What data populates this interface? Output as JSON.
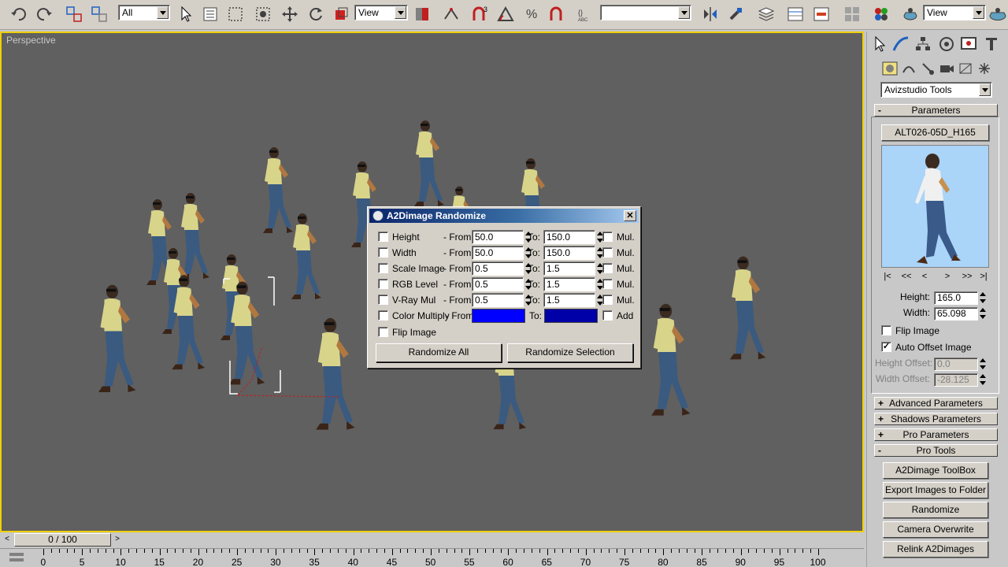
{
  "toolbar": {
    "selection_filter": "All",
    "coord_system_1": "View",
    "named_selection": "",
    "coord_system_2": "View"
  },
  "viewport": {
    "label": "Perspective"
  },
  "dialog": {
    "title": "A2Dimage Randomize",
    "close": "✕",
    "rows": [
      {
        "label": "Height",
        "from_label": "- From:",
        "from": "50.0",
        "to_label": "To:",
        "to": "150.0",
        "mul_label": "Mul."
      },
      {
        "label": "Width",
        "from_label": "- From:",
        "from": "50.0",
        "to_label": "To:",
        "to": "150.0",
        "mul_label": "Mul."
      },
      {
        "label": "Scale Image",
        "from_label": "- From:",
        "from": "0.5",
        "to_label": "To:",
        "to": "1.5",
        "mul_label": "Mul."
      },
      {
        "label": "RGB Level",
        "from_label": "- From:",
        "from": "0.5",
        "to_label": "To:",
        "to": "1.5",
        "mul_label": "Mul."
      },
      {
        "label": "V-Ray Mul",
        "from_label": "- From:",
        "from": "0.5",
        "to_label": "To:",
        "to": "1.5",
        "mul_label": "Mul."
      }
    ],
    "color_row": {
      "label": "Color Multiply",
      "from_label": "- From:",
      "to_label": "To:",
      "add_label": "Add",
      "from_color": "#0000ff",
      "to_color": "#0000a8"
    },
    "flip_label": "Flip Image",
    "randomize_all": "Randomize All",
    "randomize_selection": "Randomize Selection"
  },
  "panel": {
    "tools_dropdown": "Avizstudio Tools",
    "parameters_title": "Parameters",
    "image_name": "ALT026-05D_H165",
    "nav": [
      "|<",
      "<<",
      "<",
      ">",
      ">>",
      ">|"
    ],
    "height_label": "Height:",
    "height_value": "165.0",
    "width_label": "Width:",
    "width_value": "65.098",
    "flip_label": "Flip Image",
    "auto_offset_label": "Auto Offset Image",
    "auto_offset_check": "✓",
    "height_offset_label": "Height Offset:",
    "height_offset_value": "0.0",
    "width_offset_label": "Width Offset:",
    "width_offset_value": "-28.125",
    "rollouts": [
      {
        "sign": "-",
        "label": "Parameters"
      },
      {
        "sign": "+",
        "label": "Advanced Parameters"
      },
      {
        "sign": "+",
        "label": "Shadows Parameters"
      },
      {
        "sign": "+",
        "label": "Pro Parameters"
      },
      {
        "sign": "-",
        "label": "Pro Tools"
      }
    ],
    "pro_tools": [
      "A2Dimage ToolBox",
      "Export Images to Folder",
      "Randomize",
      "Camera Overwrite",
      "Relink A2Dimages"
    ]
  },
  "timeline": {
    "frame_display": "0 / 100",
    "left_arrow": "<",
    "right_arrow": ">",
    "ticks": [
      "0",
      "5",
      "10",
      "15",
      "20",
      "25",
      "30",
      "35",
      "40",
      "45",
      "50",
      "55",
      "60",
      "65",
      "70",
      "75",
      "80",
      "85",
      "90",
      "95",
      "100"
    ]
  },
  "colors": {
    "viewport_bg": "#606060",
    "viewport_border": "#f0d000",
    "preview_bg": "#aad4f8",
    "title_bar": "#0a246a"
  }
}
